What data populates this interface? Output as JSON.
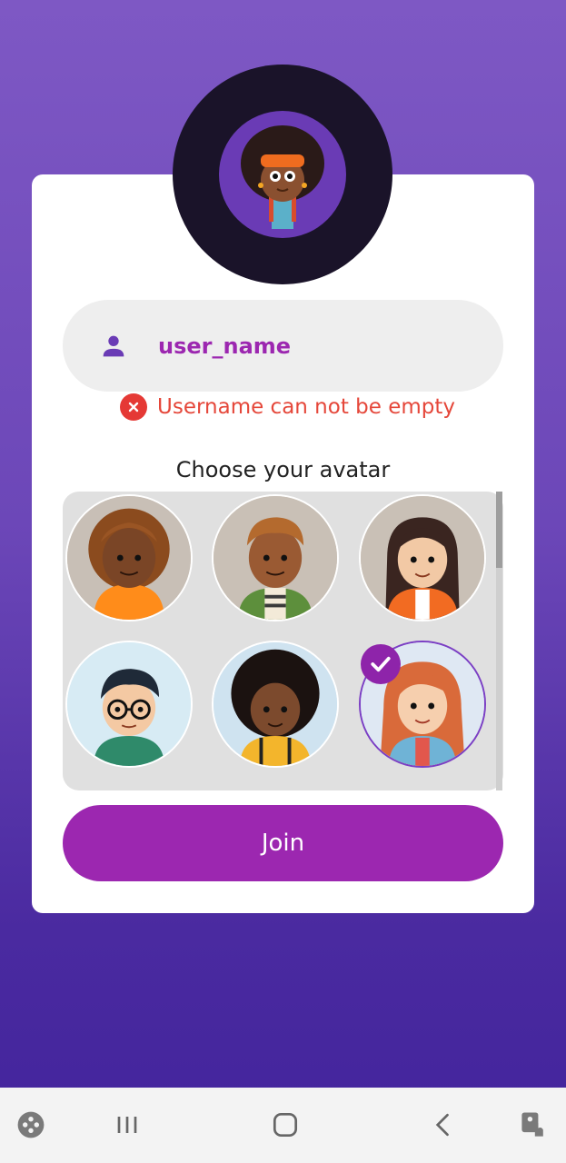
{
  "username": {
    "value": "user_name",
    "icon": "person-icon",
    "error": "Username can not be empty"
  },
  "avatars": {
    "label": "Choose your avatar",
    "selected_index": 5,
    "items": [
      {
        "icon": "avatar-girl-curly-orange"
      },
      {
        "icon": "avatar-boy-green-jacket"
      },
      {
        "icon": "avatar-girl-orange-jacket"
      },
      {
        "icon": "avatar-boy-glasses"
      },
      {
        "icon": "avatar-boy-afro"
      },
      {
        "icon": "avatar-girl-red-hair"
      }
    ]
  },
  "join_label": "Join",
  "colors": {
    "accent": "#9c27b0",
    "error": "#e53935",
    "background_top": "#7e58c4",
    "background_bottom": "#42249c"
  },
  "navbar": {
    "items": [
      "game-launcher-icon",
      "recent-apps-icon",
      "home-icon",
      "back-icon",
      "accessibility-icon"
    ]
  }
}
